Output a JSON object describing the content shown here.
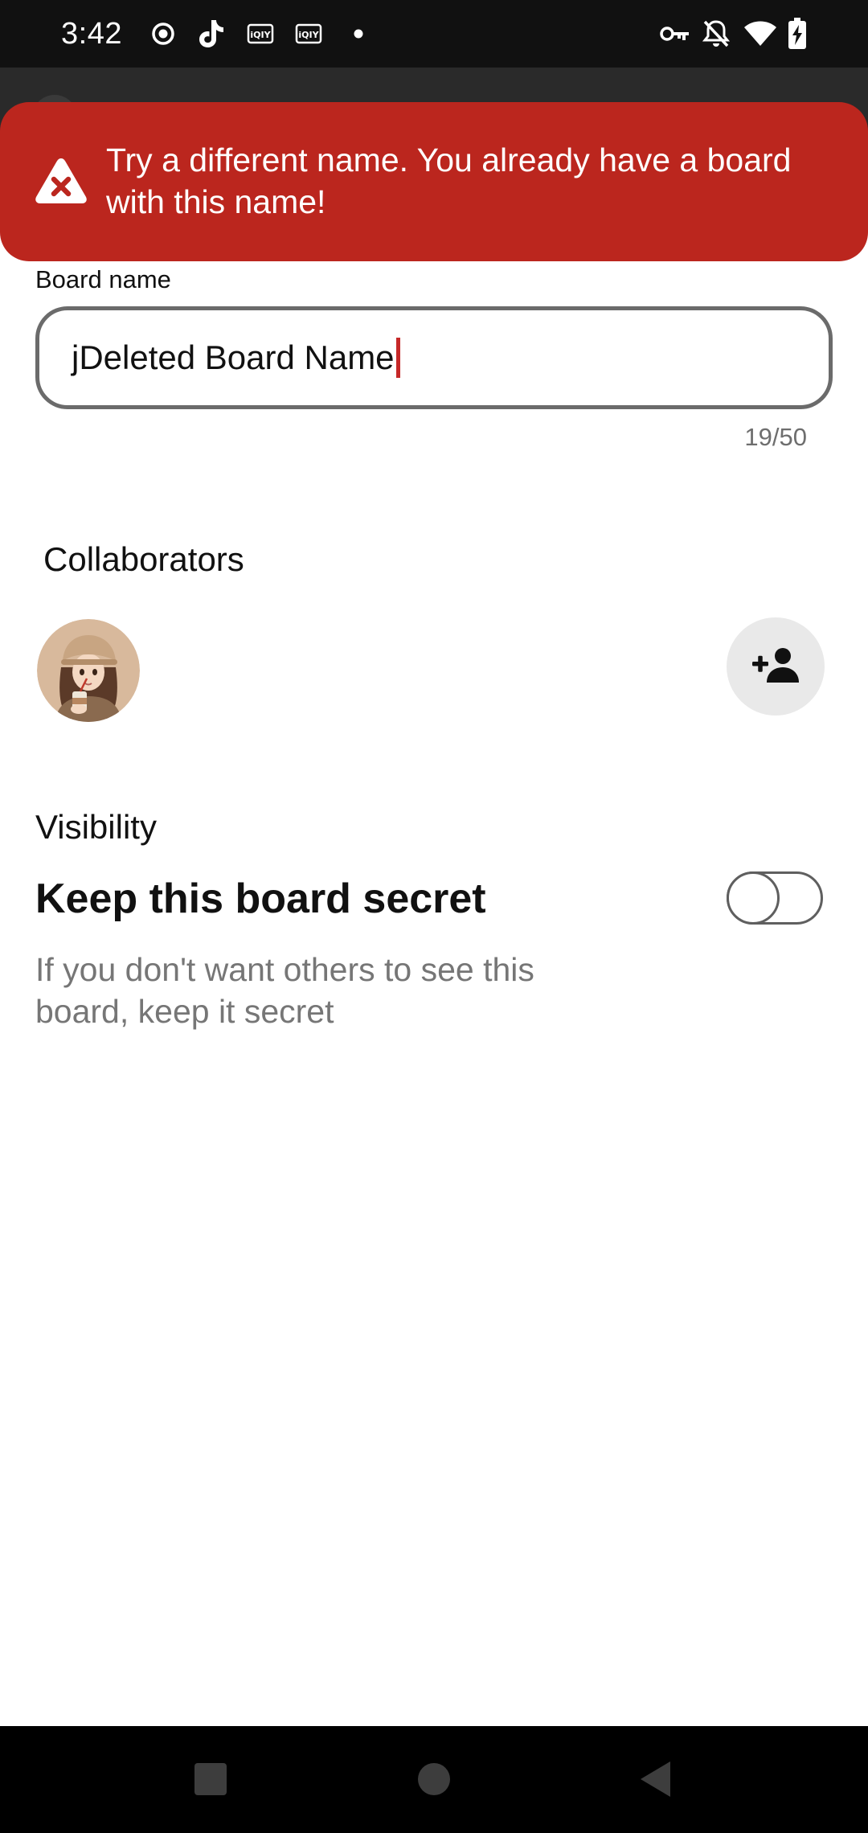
{
  "status_bar": {
    "time": "3:42",
    "left_icons": [
      "record-icon",
      "tiktok-icon",
      "iqiyi-icon",
      "iqiyi-icon",
      "dot-icon"
    ],
    "right_icons": [
      "key-icon",
      "notifications-off-icon",
      "wifi-icon",
      "battery-charging-icon"
    ]
  },
  "toast": {
    "message": "Try a different name. You already have a board with this name!",
    "icon": "warning-error-icon",
    "color": "#bb261e"
  },
  "board_name": {
    "label": "Board name",
    "value": "jDeleted Board Name",
    "char_count": "19/50"
  },
  "collaborators": {
    "title": "Collaborators",
    "add_icon": "add-person-icon"
  },
  "visibility": {
    "label": "Visibility",
    "secret_title": "Keep this board secret",
    "secret_description": "If you don't want others to see this board, keep it secret",
    "secret_enabled": false
  },
  "nav": {
    "icons": [
      "recents-square-icon",
      "home-circle-icon",
      "back-triangle-icon"
    ]
  }
}
